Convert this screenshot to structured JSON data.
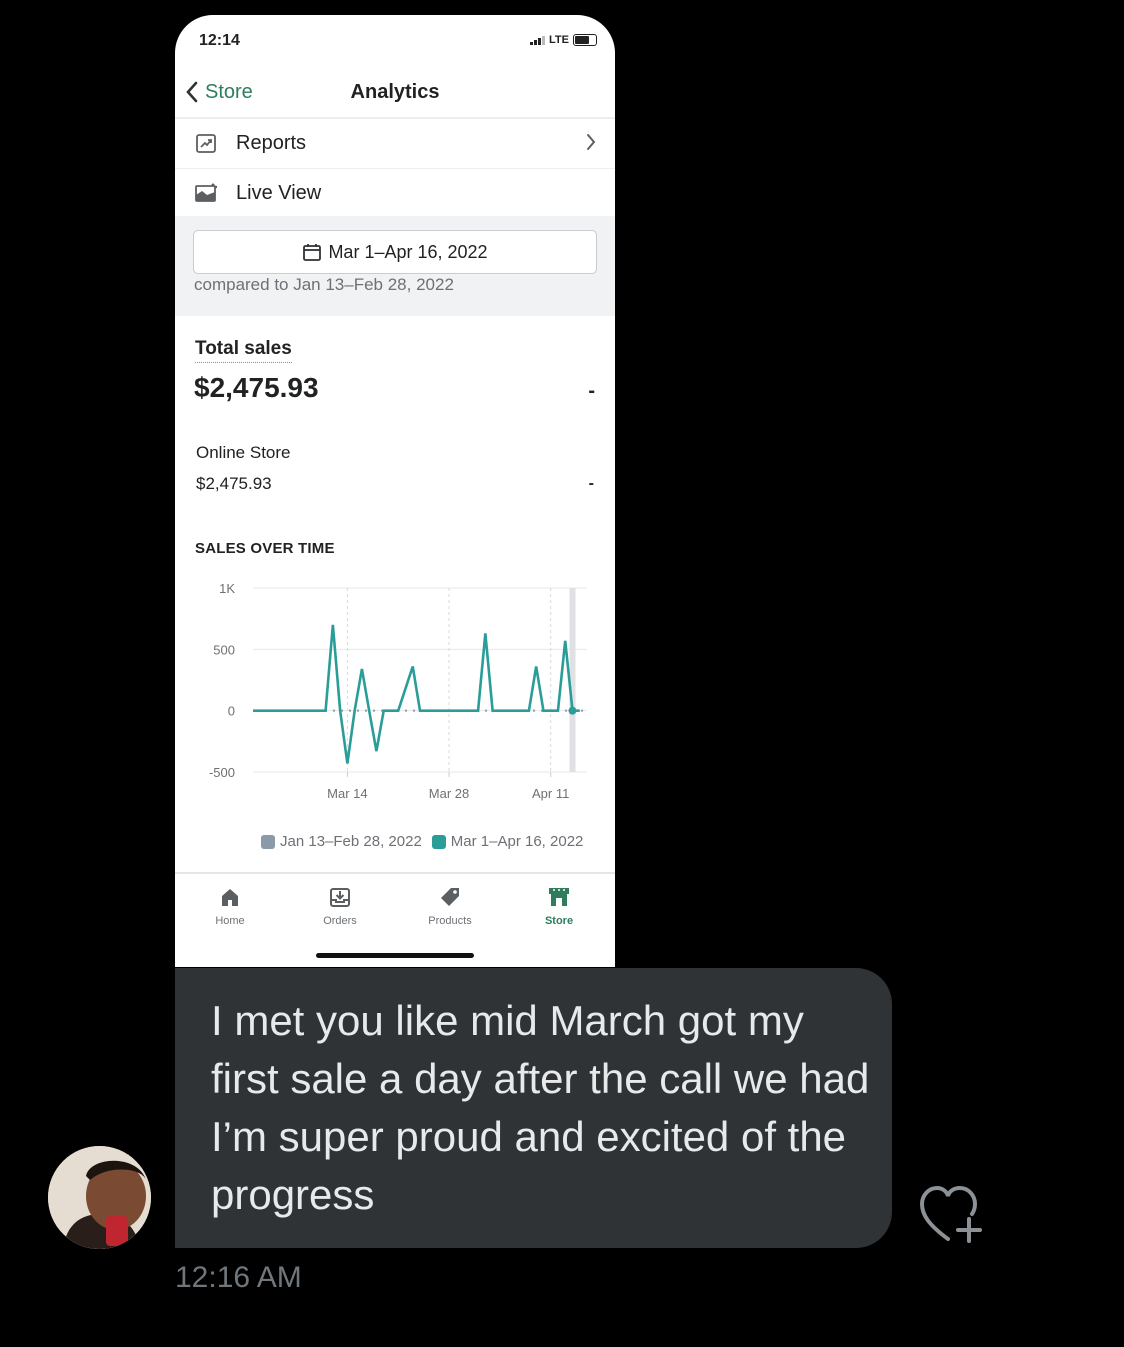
{
  "status_bar": {
    "time": "12:14",
    "network": "LTE"
  },
  "nav": {
    "back_label": "Store",
    "title": "Analytics"
  },
  "menu": [
    {
      "label": "Reports",
      "icon": "reports-icon"
    },
    {
      "label": "Live View",
      "icon": "live-view-icon"
    }
  ],
  "date_range": {
    "label": "Mar 1–Apr 16, 2022",
    "compared": "compared to Jan 13–Feb 28, 2022"
  },
  "total_sales": {
    "label": "Total sales",
    "value": "$2,475.93",
    "change": "-"
  },
  "online_store": {
    "label": "Online Store",
    "value": "$2,475.93",
    "change": "-"
  },
  "sales_over_time": {
    "title": "SALES OVER TIME"
  },
  "chart_data": {
    "type": "line",
    "title": "SALES OVER TIME",
    "y_ticks": [
      "1K",
      "500",
      "0",
      "-500"
    ],
    "ylim": [
      -500,
      1000
    ],
    "x_ticks": [
      "Mar 14",
      "Mar 28",
      "Apr 11"
    ],
    "x_tick_days": [
      13,
      27,
      41
    ],
    "xlim": [
      0,
      46
    ],
    "grid": true,
    "legend_position": "bottom",
    "series": [
      {
        "name": "Jan 13–Feb 28, 2022",
        "color": "#8a9aa9",
        "x": [
          0,
          46
        ],
        "y": [
          0,
          0
        ]
      },
      {
        "name": "Mar 1–Apr 16, 2022",
        "color": "#2a9d98",
        "x": [
          0,
          10,
          11,
          12,
          13,
          14,
          15,
          16,
          17,
          18,
          20,
          22,
          23,
          24,
          31,
          32,
          33,
          38,
          39,
          40,
          42,
          43,
          44,
          45
        ],
        "y": [
          0,
          0,
          700,
          0,
          -430,
          0,
          340,
          0,
          -330,
          0,
          0,
          360,
          0,
          0,
          0,
          630,
          0,
          0,
          360,
          0,
          0,
          570,
          0,
          0
        ]
      }
    ],
    "highlight_date": "Apr 14"
  },
  "tabs": [
    {
      "label": "Home",
      "icon": "home-icon",
      "active": false
    },
    {
      "label": "Orders",
      "icon": "orders-icon",
      "active": false
    },
    {
      "label": "Products",
      "icon": "products-tag-icon",
      "active": false
    },
    {
      "label": "Store",
      "icon": "store-icon",
      "active": true
    }
  ],
  "message": {
    "text": "I met you like mid March got my first sale a day after the call we had I’m super proud and excited of the progress",
    "time": "12:16 AM"
  },
  "colors": {
    "accent": "#2f7d5c",
    "line": "#2a9d98",
    "bubble": "#2f3336",
    "background": "#000000"
  }
}
